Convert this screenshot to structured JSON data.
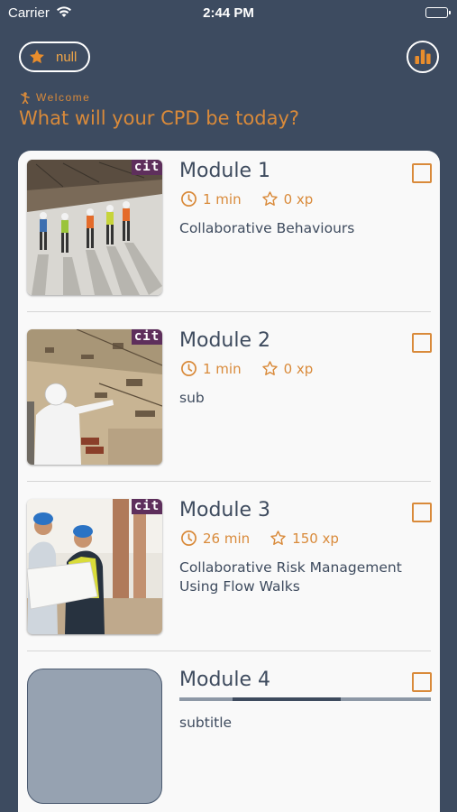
{
  "status_bar": {
    "carrier": "Carrier",
    "time": "2:44 PM"
  },
  "header": {
    "points_value": "null",
    "welcome": "Welcome",
    "headline": "What will your CPD be today?"
  },
  "colors": {
    "background": "#3d4b60",
    "accent": "#d98a3a",
    "card": "#f9f9f9",
    "text": "#3e4b5e",
    "badge": "#5e2f5c"
  },
  "modules": [
    {
      "title": "Module 1",
      "duration": "1 min",
      "xp": "0 xp",
      "subtitle": "Collaborative Behaviours",
      "badge": "cit",
      "completed": false
    },
    {
      "title": "Module 2",
      "duration": "1 min",
      "xp": "0 xp",
      "subtitle": "sub",
      "badge": "cit",
      "completed": false
    },
    {
      "title": "Module 3",
      "duration": "26 min",
      "xp": "150 xp",
      "subtitle": "Collaborative Risk Management Using Flow Walks",
      "badge": "cit",
      "completed": false
    },
    {
      "title": "Module 4",
      "subtitle": "subtitle",
      "completed": false,
      "loading_progress": 0.43
    }
  ],
  "icons": {
    "points": "star-icon",
    "stats": "bar-chart-icon",
    "welcome": "waving-figure-icon",
    "duration": "clock-icon",
    "xp": "star-outline-icon",
    "checkbox": "checkbox-icon"
  }
}
